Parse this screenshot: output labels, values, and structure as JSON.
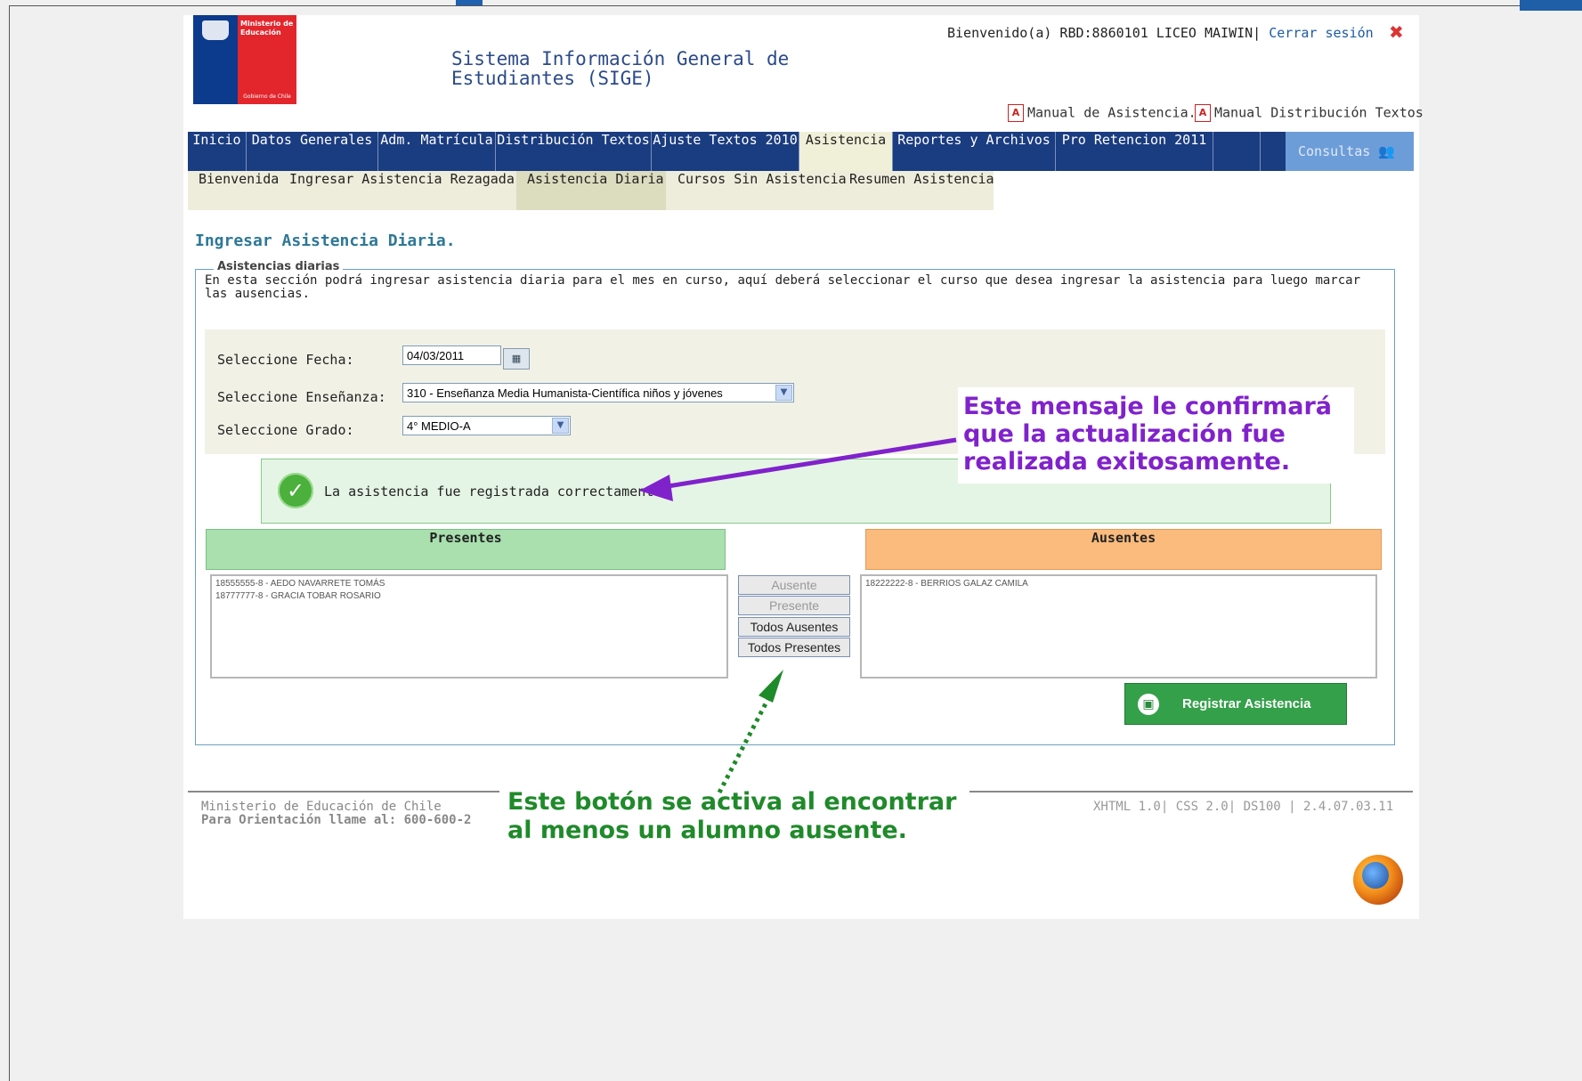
{
  "header": {
    "logo_line1": "Ministerio de",
    "logo_line2": "Educación",
    "logo_footer": "Gobierno de Chile",
    "system_title": "Sistema Información General de Estudiantes (SIGE)",
    "welcome_text": "Bienvenido(a) RBD:8860101  LICEO MAIWIN|",
    "logout_label": "Cerrar sesión",
    "manual_asistencia": "Manual de Asistencia.",
    "manual_distribucion": "Manual Distribución Textos"
  },
  "nav": {
    "items": [
      "Inicio",
      "Datos Generales",
      "Adm. Matrícula",
      "Distribución Textos",
      "Ajuste Textos 2010",
      "Asistencia",
      "Reportes y Archivos",
      "Pro Retencion 2011"
    ],
    "active": "Asistencia",
    "consultas": "Consultas"
  },
  "subnav": {
    "items": [
      "Bienvenida",
      "Ingresar Asistencia Rezagada",
      "Asistencia Diaria",
      "Cursos Sin Asistencia",
      "Resumen Asistencia"
    ],
    "active": "Asistencia Diaria"
  },
  "main": {
    "title": "Ingresar Asistencia Diaria.",
    "legend": "Asistencias diarias",
    "intro": "En esta sección podrá ingresar asistencia diaria para el mes en curso, aquí deberá seleccionar el curso que desea ingresar la asistencia para luego marcar las ausencias.",
    "fecha_label": "Seleccione Fecha:",
    "fecha_value": "04/03/2011",
    "ensenanza_label": "Seleccione Enseñanza:",
    "ensenanza_value": "310 - Enseñanza Media Humanista-Científica niños y jóvenes",
    "grado_label": "Seleccione Grado:",
    "grado_value": "4° MEDIO-A",
    "success_message": "La asistencia fue registrada correctamente.",
    "presentes_header": "Presentes",
    "ausentes_header": "Ausentes",
    "presentes": [
      "18555555-8 - AEDO NAVARRETE TOMÁS",
      "18777777-8 - GRACIA TOBAR ROSARIO"
    ],
    "ausentes": [
      "18222222-8 - BERRIOS GALAZ CAMILA"
    ],
    "btn_ausente": "Ausente",
    "btn_presente": "Presente",
    "btn_todos_ausentes": "Todos Ausentes",
    "btn_todos_presentes": "Todos Presentes",
    "btn_registrar": "Registrar Asistencia"
  },
  "footer": {
    "line1": "Ministerio de Educación de Chile",
    "line2": "Para Orientación llame al: 600-600-2",
    "right": "XHTML 1.0| CSS 2.0| DS100 | 2.4.07.03.11"
  },
  "annotations": {
    "note1": "Este mensaje le confirmará que la actualización fue realizada exitosamente.",
    "note2": "Este botón se activa al encontrar al menos un alumno ausente."
  },
  "colors": {
    "nav_bg": "#1a3c80",
    "note1": "#8022cc",
    "note2": "#1f8a2a",
    "presentes_bg": "#a9e0ae",
    "ausentes_bg": "#fbbb7d",
    "register_bg": "#34a04a"
  }
}
